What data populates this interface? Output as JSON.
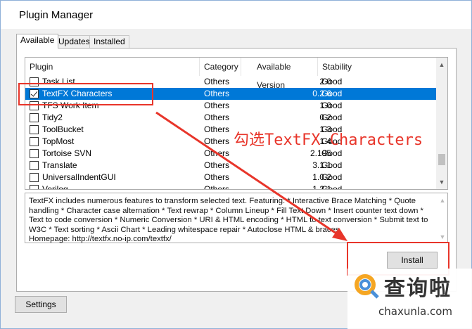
{
  "window": {
    "title": "Plugin Manager"
  },
  "tabs": [
    "Available",
    "Updates",
    "Installed"
  ],
  "columns": {
    "plugin": "Plugin",
    "category": "Category",
    "version": "Available Version",
    "stability": "Stability"
  },
  "rows": [
    {
      "name": "Task List",
      "category": "Others",
      "version": "2.0",
      "stability": "Good",
      "checked": false,
      "selected": false
    },
    {
      "name": "TextFX Characters",
      "category": "Others",
      "version": "0.2.6",
      "stability": "Good",
      "checked": true,
      "selected": true
    },
    {
      "name": "TFS Work Item",
      "category": "Others",
      "version": "1.0",
      "stability": "Good",
      "checked": false,
      "selected": false
    },
    {
      "name": "Tidy2",
      "category": "Others",
      "version": "0.2",
      "stability": "Good",
      "checked": false,
      "selected": false
    },
    {
      "name": "ToolBucket",
      "category": "Others",
      "version": "1.3",
      "stability": "Good",
      "checked": false,
      "selected": false
    },
    {
      "name": "TopMost",
      "category": "Others",
      "version": "1.4",
      "stability": "Good",
      "checked": false,
      "selected": false
    },
    {
      "name": "Tortoise SVN",
      "category": "Others",
      "version": "2.195",
      "stability": "Good",
      "checked": false,
      "selected": false
    },
    {
      "name": "Translate",
      "category": "Others",
      "version": "3.1.1",
      "stability": "Good",
      "checked": false,
      "selected": false
    },
    {
      "name": "UniversalIndentGUI",
      "category": "Others",
      "version": "1.0.2",
      "stability": "Good",
      "checked": false,
      "selected": false
    },
    {
      "name": "Verilog",
      "category": "Others",
      "version": "1.2.1",
      "stability": "Good",
      "checked": false,
      "selected": false
    }
  ],
  "description": "TextFX includes numerous features to transform selected text. Featuring: * Interactive Brace Matching * Quote handling * Character case alternation * Text rewrap * Column Lineup * Fill Text Down * Insert counter text down * Text to code conversion * Numeric Conversion * URI & HTML encoding * HTML to text conversion * Submit text to W3C * Text sorting * Ascii Chart * Leading whitespace repair * Autoclose HTML & braces\nHomepage: http://textfx.no-ip.com/textfx/",
  "buttons": {
    "install": "Install",
    "settings": "Settings"
  },
  "annotation": "勾选TextFX Characters",
  "watermark": {
    "cn": "查询啦",
    "en": "chaxunla.com"
  },
  "colors": {
    "selection": "#0078d7",
    "annotation": "#e8352a"
  }
}
